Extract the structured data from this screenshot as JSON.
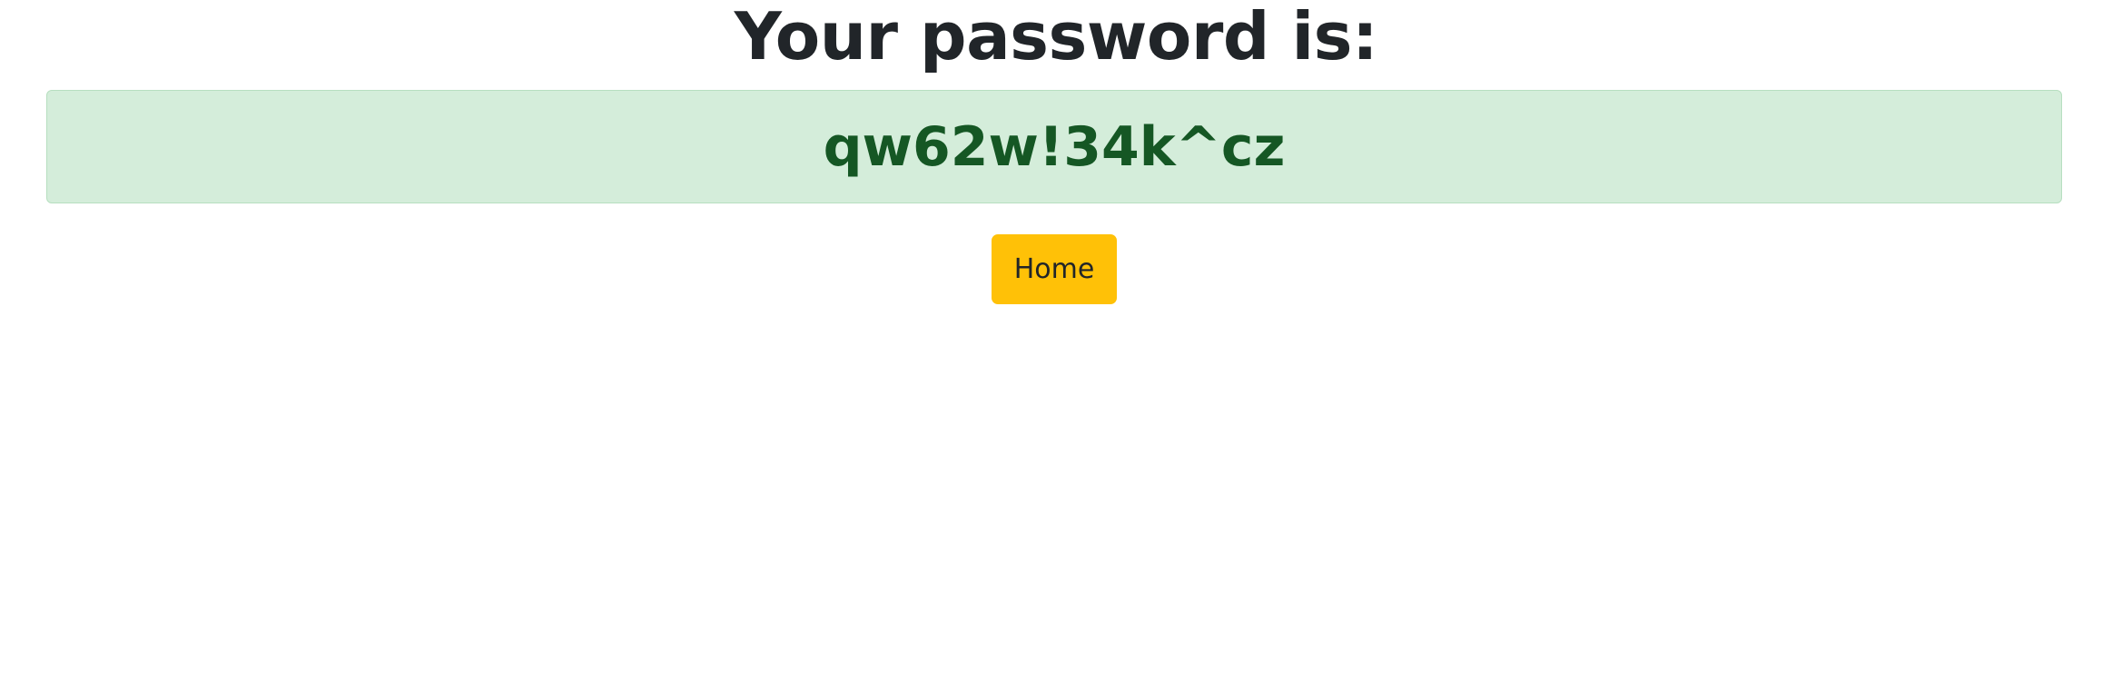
{
  "heading": "Your password is:",
  "password": "qw62w!34k^cz",
  "home_button": {
    "label": "Home"
  },
  "colors": {
    "alert_background": "#d4edda",
    "alert_border": "#b7dfc0",
    "password_text": "#155724",
    "button_background": "#ffc107",
    "heading_text": "#212529"
  }
}
